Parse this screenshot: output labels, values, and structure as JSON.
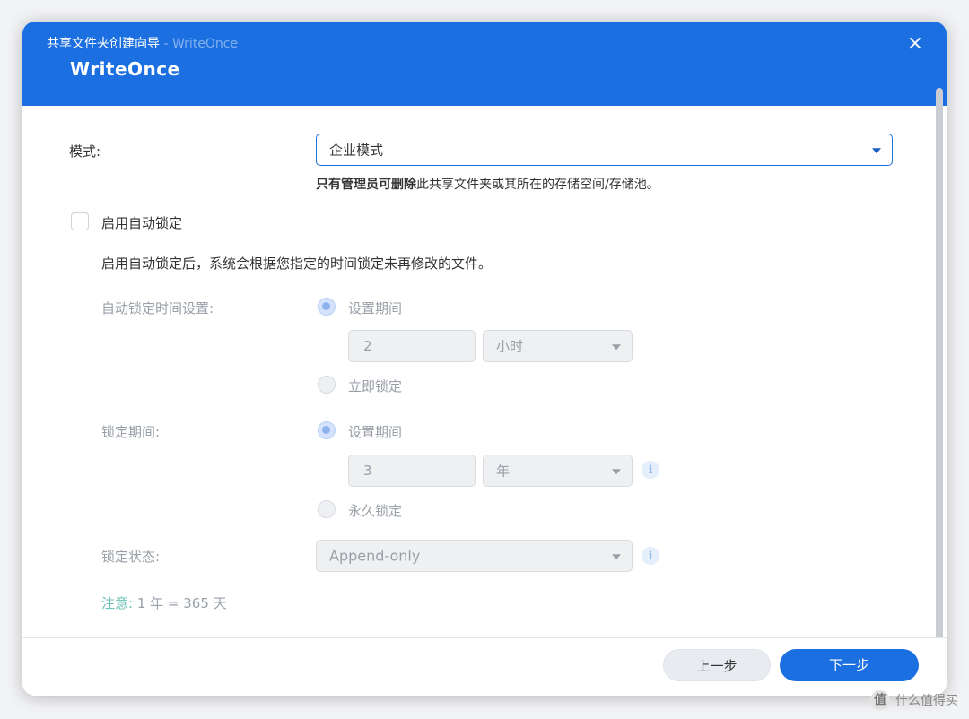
{
  "window": {
    "title": "共享文件夹创建向导",
    "separator": " - ",
    "subtitle": "WriteOnce",
    "heading": "WriteOnce",
    "close_icon": "×"
  },
  "mode": {
    "label": "模式:",
    "value": "企业模式",
    "hint_bold": "只有管理员可删除",
    "hint_rest": "此共享文件夹或其所在的存储空间/存储池。"
  },
  "auto_lock": {
    "checkbox_label": "启用自动锁定",
    "checked": false,
    "description": "启用自动锁定后，系统会根据您指定的时间锁定未再修改的文件。",
    "time_setting_label": "自动锁定时间设置:",
    "option_period": "设置期间",
    "period_value": "2",
    "period_unit": "小时",
    "option_immediate": "立即锁定"
  },
  "lock_period": {
    "label": "锁定期间:",
    "option_period": "设置期间",
    "period_value": "3",
    "period_unit": "年",
    "option_forever": "永久锁定"
  },
  "lock_state": {
    "label": "锁定状态:",
    "value": "Append-only"
  },
  "note": {
    "key": "注意:",
    "text": "1 年 = 365 天"
  },
  "footer": {
    "back_label": "上一步",
    "next_label": "下一步"
  },
  "watermark": {
    "logo": "值",
    "text": "什么值得买"
  },
  "colors": {
    "accent": "#1c6fe0",
    "note_key": "#6bc2b6"
  }
}
